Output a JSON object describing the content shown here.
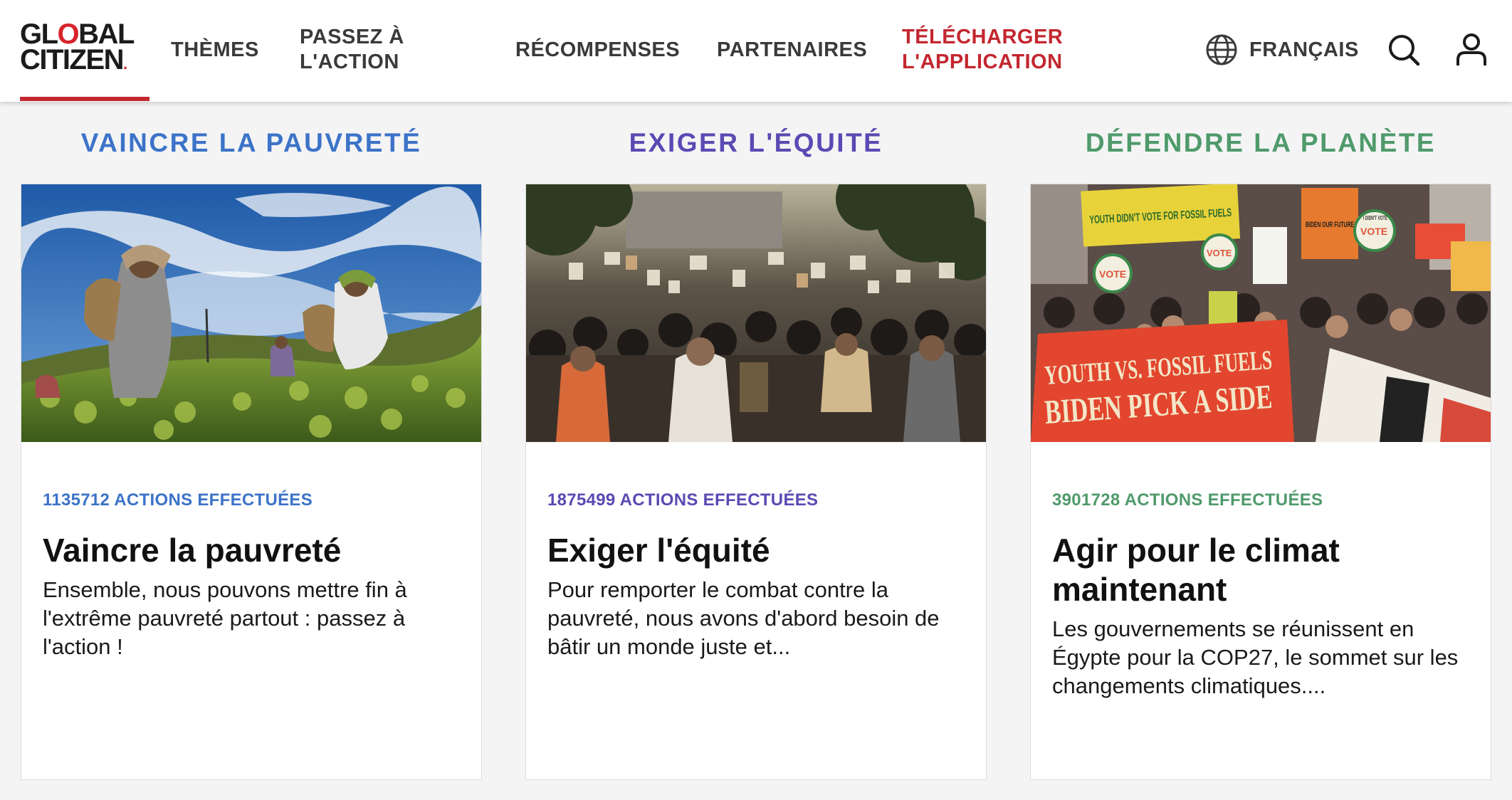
{
  "header": {
    "logo": {
      "line1": "GLOBAL",
      "line2": "CITIZEN",
      "accent_color": "#d8232a"
    },
    "nav": {
      "themes": "THÈMES",
      "take_action_line1": "PASSEZ À",
      "take_action_line2": "L'ACTION",
      "rewards": "RÉCOMPENSES",
      "partners": "PARTENAIRES",
      "download_line1": "TÉLÉCHARGER",
      "download_line2": "L'APPLICATION"
    },
    "language": {
      "label": "FRANÇAIS",
      "icon": "globe-icon"
    },
    "search_icon": "search-icon",
    "account_icon": "user-icon"
  },
  "colors": {
    "brand_red": "#c3272f",
    "poverty_blue": "#3c73c8",
    "equity_purple": "#5b49b3",
    "planet_green": "#4f9a6b"
  },
  "columns": [
    {
      "heading": "VAINCRE LA PAUVRETÉ",
      "color": "#3c73c8",
      "card": {
        "count": "1135712 ACTIONS EFFECTUÉES",
        "title": "Vaincre la pauvreté",
        "description": "Ensemble, nous pouvons mettre fin à l'extrême pauvreté partout : passez à l'action !",
        "image": "tea-pickers-photo"
      }
    },
    {
      "heading": "EXIGER L'ÉQUITÉ",
      "color": "#5b49b3",
      "card": {
        "count": "1875499 ACTIONS EFFECTUÉES",
        "title": "Exiger l'équité",
        "description": "Pour remporter le combat contre la pauvreté, nous avons d'abord besoin de bâtir un monde juste et...",
        "image": "street-protest-photo"
      }
    },
    {
      "heading": "DÉFENDRE LA PLANÈTE",
      "color": "#4f9a6b",
      "card": {
        "count": "3901728 ACTIONS EFFECTUÉES",
        "title": "Agir pour le climat maintenant",
        "description": "Les gouvernements se réunissent en Égypte pour la COP27, le sommet sur les changements climatiques....",
        "image": "climate-march-photo",
        "banner_lines": [
          "YOUTH VS. FOSSIL FUELS",
          "BIDEN PICK A SIDE"
        ],
        "sign_top": "YOUTH DIDN'T VOTE FOR FOSSIL FUELS",
        "sign_vote": "VOTE",
        "sign_biden": "BIDEN OUR FUTURE",
        "sign_small": "I DIDN'T VOTE"
      }
    }
  ]
}
